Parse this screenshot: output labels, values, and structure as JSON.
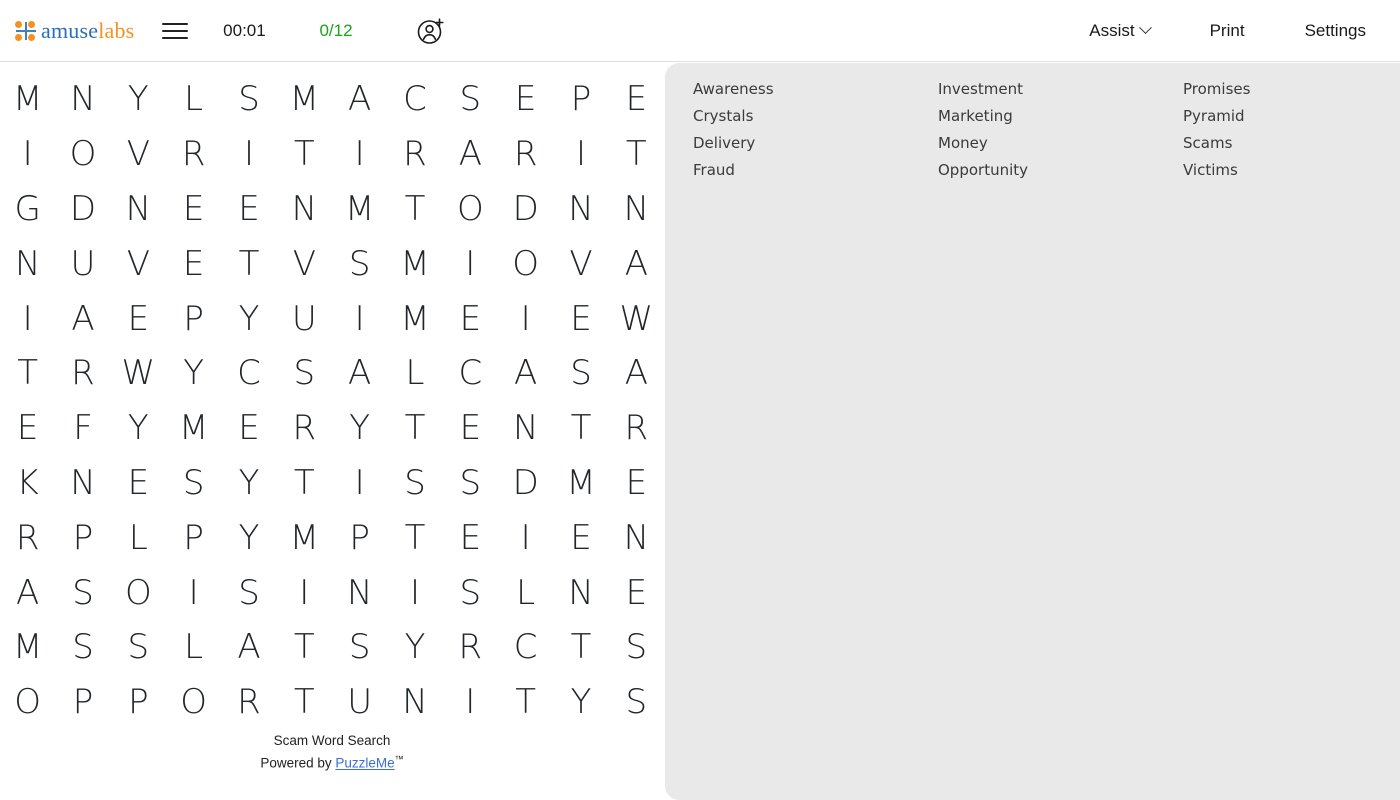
{
  "header": {
    "logo": {
      "part1": "amuse",
      "part2": "labs",
      "name": "amuselabs"
    },
    "menu_icon": "hamburger-menu-icon",
    "timer": "00:01",
    "progress": "0/12",
    "add_user_icon": "add-user-icon",
    "assist_label": "Assist",
    "print_label": "Print",
    "settings_label": "Settings"
  },
  "puzzle": {
    "title": "Scam Word Search",
    "powered_by_prefix": "Powered by ",
    "powered_by_link": "PuzzleMe",
    "trademark": "™",
    "rows": 12,
    "cols": 12,
    "grid": [
      [
        "M",
        "N",
        "Y",
        "L",
        "S",
        "M",
        "A",
        "C",
        "S",
        "E",
        "P",
        "E"
      ],
      [
        "I",
        "O",
        "V",
        "R",
        "I",
        "T",
        "I",
        "R",
        "A",
        "R",
        "I",
        "T"
      ],
      [
        "G",
        "D",
        "N",
        "E",
        "E",
        "N",
        "M",
        "T",
        "O",
        "D",
        "N",
        "N"
      ],
      [
        "N",
        "U",
        "V",
        "E",
        "T",
        "V",
        "S",
        "M",
        "I",
        "O",
        "V",
        "A"
      ],
      [
        "I",
        "A",
        "E",
        "P",
        "Y",
        "U",
        "I",
        "M",
        "E",
        "I",
        "E",
        "W"
      ],
      [
        "T",
        "R",
        "W",
        "Y",
        "C",
        "S",
        "A",
        "L",
        "C",
        "A",
        "S",
        "A"
      ],
      [
        "E",
        "F",
        "Y",
        "M",
        "E",
        "R",
        "Y",
        "T",
        "E",
        "N",
        "T",
        "R"
      ],
      [
        "K",
        "N",
        "E",
        "S",
        "Y",
        "T",
        "I",
        "S",
        "S",
        "D",
        "M",
        "E"
      ],
      [
        "R",
        "P",
        "L",
        "P",
        "Y",
        "M",
        "P",
        "T",
        "E",
        "I",
        "E",
        "N"
      ],
      [
        "A",
        "S",
        "O",
        "I",
        "S",
        "I",
        "N",
        "I",
        "S",
        "L",
        "N",
        "E"
      ],
      [
        "M",
        "S",
        "S",
        "L",
        "A",
        "T",
        "S",
        "Y",
        "R",
        "C",
        "T",
        "S"
      ],
      [
        "O",
        "P",
        "P",
        "O",
        "R",
        "T",
        "U",
        "N",
        "I",
        "T",
        "Y",
        "S"
      ]
    ]
  },
  "wordlist": {
    "words": [
      "Awareness",
      "Investment",
      "Promises",
      "Crystals",
      "Marketing",
      "Pyramid",
      "Delivery",
      "Money",
      "Scams",
      "Fraud",
      "Opportunity",
      "Victims"
    ]
  },
  "colors": {
    "logo_blue": "#2a6ebb",
    "logo_orange": "#f5911e",
    "progress_green": "#1aa41a",
    "panel_bg": "#e9e9e9",
    "link_blue": "#3a6fd8",
    "grid_letter": "#222629"
  }
}
